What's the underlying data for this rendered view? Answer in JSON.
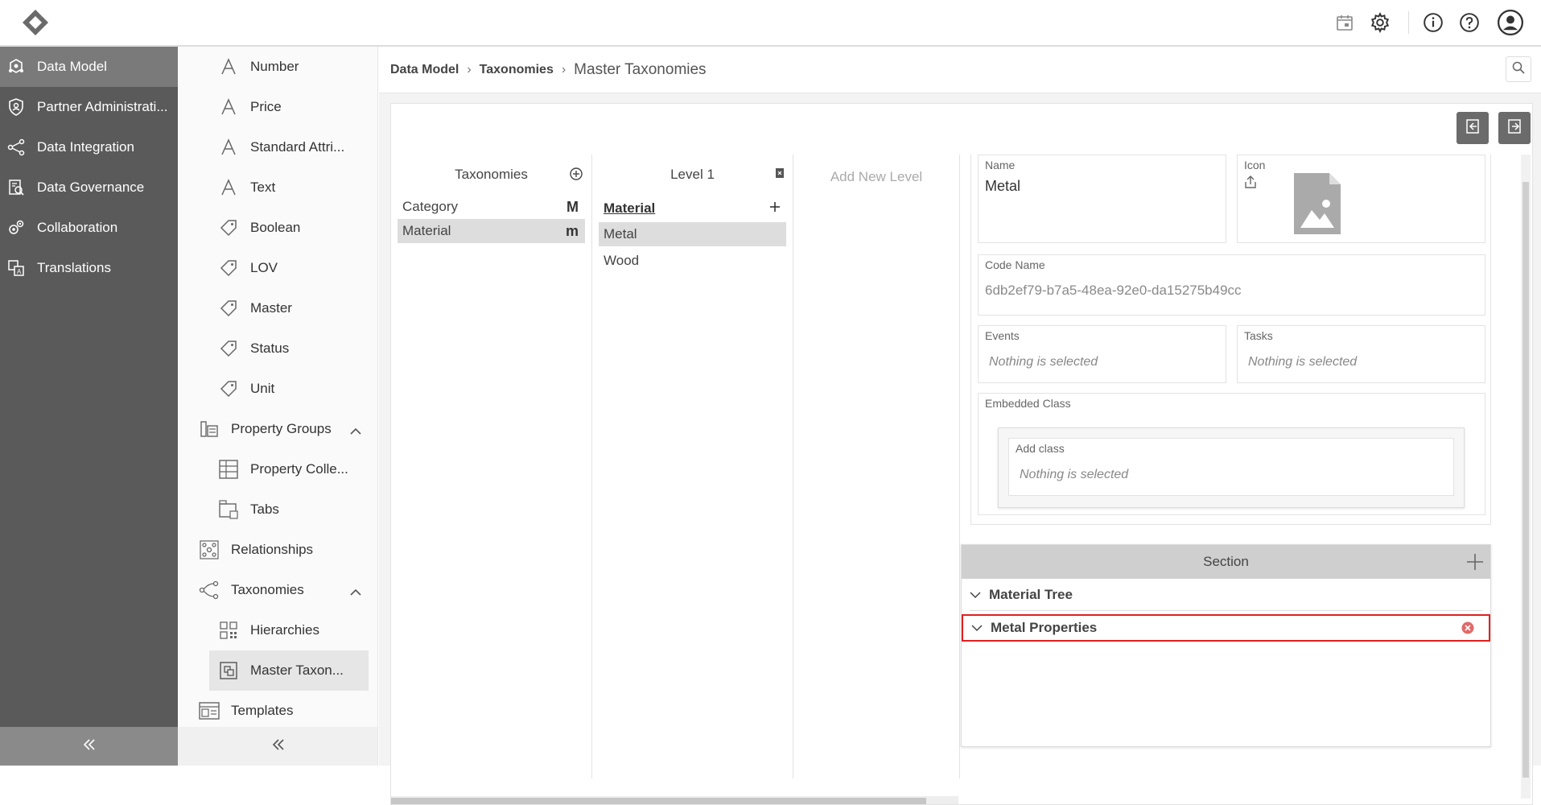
{
  "topbar": {
    "icons": [
      "logo-icon",
      "calendar-icon",
      "gear-icon",
      "info-icon",
      "help-icon",
      "user-icon"
    ]
  },
  "sidebar": {
    "items": [
      {
        "label": "Data Model",
        "icon": "data-model-icon",
        "active": true
      },
      {
        "label": "Partner Administrati...",
        "icon": "shield-icon",
        "active": false
      },
      {
        "label": "Data Integration",
        "icon": "integration-icon",
        "active": false
      },
      {
        "label": "Data Governance",
        "icon": "governance-icon",
        "active": false
      },
      {
        "label": "Collaboration",
        "icon": "collaboration-icon",
        "active": false
      },
      {
        "label": "Translations",
        "icon": "translations-icon",
        "active": false
      }
    ]
  },
  "subnav": {
    "items": [
      {
        "label": "Number",
        "icon": "attribute-icon"
      },
      {
        "label": "Price",
        "icon": "attribute-icon"
      },
      {
        "label": "Standard Attri...",
        "icon": "attribute-icon"
      },
      {
        "label": "Text",
        "icon": "attribute-icon"
      },
      {
        "label": "Boolean",
        "icon": "tag-icon"
      },
      {
        "label": "LOV",
        "icon": "tag-icon"
      },
      {
        "label": "Master",
        "icon": "tag-icon"
      },
      {
        "label": "Status",
        "icon": "tag-icon"
      },
      {
        "label": "Unit",
        "icon": "tag-icon"
      },
      {
        "label": "Property Groups",
        "icon": "property-groups-icon"
      },
      {
        "label": "Property Colle...",
        "icon": "table-icon"
      },
      {
        "label": "Tabs",
        "icon": "tabs-icon"
      },
      {
        "label": "Relationships",
        "icon": "relationships-icon"
      },
      {
        "label": "Taxonomies",
        "icon": "taxonomies-icon"
      },
      {
        "label": "Hierarchies",
        "icon": "hierarchies-icon"
      },
      {
        "label": "Master Taxon...",
        "icon": "master-taxonomy-icon"
      },
      {
        "label": "Templates",
        "icon": "templates-icon"
      }
    ]
  },
  "breadcrumb": {
    "items": [
      "Data Model",
      "Taxonomies"
    ],
    "current": "Master Taxonomies"
  },
  "taxonomies": {
    "header": "Taxonomies",
    "items": [
      {
        "label": "Category",
        "badge": "M"
      },
      {
        "label": "Material",
        "badge": "m"
      }
    ]
  },
  "level1": {
    "header": "Level 1",
    "sub_header": "Material",
    "items": [
      "Metal",
      "Wood"
    ]
  },
  "add_level": "Add New Level",
  "form": {
    "name_label": "Name",
    "name_value": "Metal",
    "icon_label": "Icon",
    "code_label": "Code Name",
    "code_value": "6db2ef79-b7a5-48ea-92e0-da15275b49cc",
    "events_label": "Events",
    "events_value": "Nothing is selected",
    "tasks_label": "Tasks",
    "tasks_value": "Nothing is selected",
    "embedded_label": "Embedded Class",
    "add_class_label": "Add class",
    "add_class_value": "Nothing is selected"
  },
  "section": {
    "header": "Section",
    "rows": [
      "Material Tree",
      "Metal Properties"
    ]
  },
  "colors": {
    "sidebar_bg": "#5a5a5a",
    "selected_outline": "#e02020",
    "remove_icon": "#e06a6a"
  }
}
